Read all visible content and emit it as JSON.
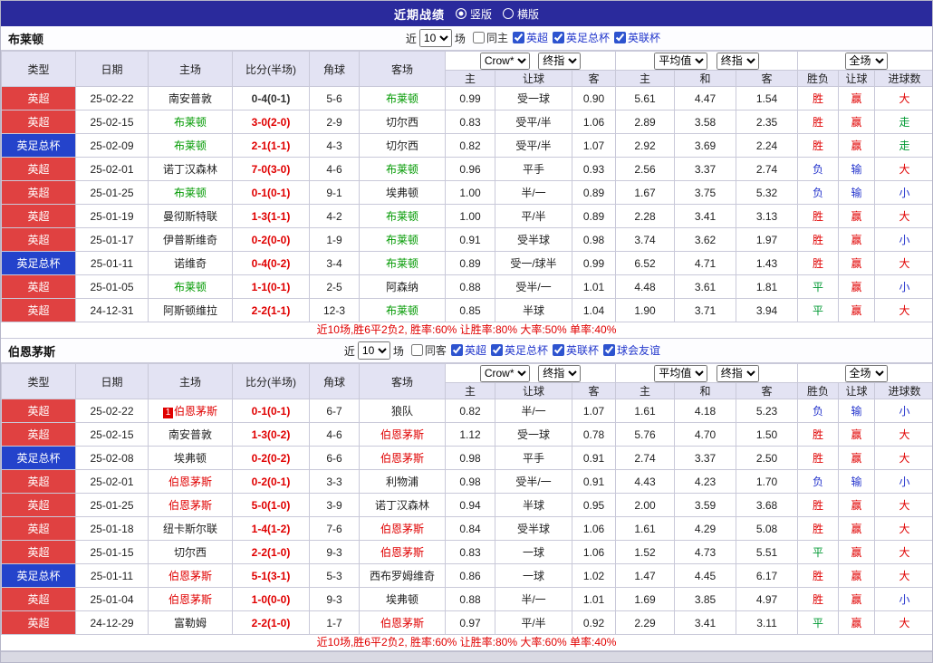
{
  "topbar": {
    "title": "近期战绩",
    "vertical_label": "竖版",
    "horizontal_label": "横版"
  },
  "colors": {
    "red": "#e00000",
    "green": "#009933",
    "blue": "#2333cc",
    "black": "#333333",
    "link": "#2136cc",
    "team_green": "#009900",
    "team_red": "#e00000",
    "comp_red": "#e04141",
    "comp_blue": "#2443cb"
  },
  "sections": [
    {
      "team": "布莱顿",
      "team_color_key": "team_green",
      "filter": {
        "near": "近",
        "count": "10",
        "games": "场",
        "checkboxes": [
          {
            "label": "同主",
            "checked": false,
            "color_key": "black"
          },
          {
            "label": "英超",
            "checked": true,
            "color_key": "link"
          },
          {
            "label": "英足总杯",
            "checked": true,
            "color_key": "link"
          },
          {
            "label": "英联杯",
            "checked": true,
            "color_key": "link"
          }
        ]
      },
      "header": {
        "cols": [
          "类型",
          "日期",
          "主场",
          "比分(半场)",
          "角球",
          "客场"
        ],
        "odds_company": "Crow*",
        "odds_stage": "终指",
        "avg_type": "平均值",
        "avg_stage": "终指",
        "scope": "全场",
        "sub_cols": [
          "主",
          "让球",
          "客",
          "主",
          "和",
          "客",
          "胜负",
          "让球",
          "进球数"
        ]
      },
      "rows": [
        {
          "comp": "英超",
          "comp_color": "red",
          "date": "25-02-22",
          "home": "南安普敦",
          "home_is_team": false,
          "card": "",
          "score": "0-4(0-1)",
          "score_color": "black",
          "corner": "5-6",
          "away": "布莱顿",
          "away_is_team": true,
          "o1": "0.99",
          "hcp": "受一球",
          "o2": "0.90",
          "m1": "5.61",
          "m2": "4.47",
          "m3": "1.54",
          "res": [
            "胜",
            "red"
          ],
          "hres": [
            "赢",
            "red"
          ],
          "goal": [
            "大",
            "red"
          ]
        },
        {
          "comp": "英超",
          "comp_color": "red",
          "date": "25-02-15",
          "home": "布莱顿",
          "home_is_team": true,
          "card": "",
          "score": "3-0(2-0)",
          "score_color": "red",
          "corner": "2-9",
          "away": "切尔西",
          "away_is_team": false,
          "o1": "0.83",
          "hcp": "受平/半",
          "o2": "1.06",
          "m1": "2.89",
          "m2": "3.58",
          "m3": "2.35",
          "res": [
            "胜",
            "red"
          ],
          "hres": [
            "赢",
            "red"
          ],
          "goal": [
            "走",
            "green"
          ]
        },
        {
          "comp": "英足总杯",
          "comp_color": "blue",
          "date": "25-02-09",
          "home": "布莱顿",
          "home_is_team": true,
          "card": "",
          "score": "2-1(1-1)",
          "score_color": "red",
          "corner": "4-3",
          "away": "切尔西",
          "away_is_team": false,
          "o1": "0.82",
          "hcp": "受平/半",
          "o2": "1.07",
          "m1": "2.92",
          "m2": "3.69",
          "m3": "2.24",
          "res": [
            "胜",
            "red"
          ],
          "hres": [
            "赢",
            "red"
          ],
          "goal": [
            "走",
            "green"
          ]
        },
        {
          "comp": "英超",
          "comp_color": "red",
          "date": "25-02-01",
          "home": "诺丁汉森林",
          "home_is_team": false,
          "card": "",
          "score": "7-0(3-0)",
          "score_color": "red",
          "corner": "4-6",
          "away": "布莱顿",
          "away_is_team": true,
          "o1": "0.96",
          "hcp": "平手",
          "o2": "0.93",
          "m1": "2.56",
          "m2": "3.37",
          "m3": "2.74",
          "res": [
            "负",
            "blue"
          ],
          "hres": [
            "输",
            "blue"
          ],
          "goal": [
            "大",
            "red"
          ]
        },
        {
          "comp": "英超",
          "comp_color": "red",
          "date": "25-01-25",
          "home": "布莱顿",
          "home_is_team": true,
          "card": "",
          "score": "0-1(0-1)",
          "score_color": "red",
          "corner": "9-1",
          "away": "埃弗顿",
          "away_is_team": false,
          "o1": "1.00",
          "hcp": "半/一",
          "o2": "0.89",
          "m1": "1.67",
          "m2": "3.75",
          "m3": "5.32",
          "res": [
            "负",
            "blue"
          ],
          "hres": [
            "输",
            "blue"
          ],
          "goal": [
            "小",
            "blue"
          ]
        },
        {
          "comp": "英超",
          "comp_color": "red",
          "date": "25-01-19",
          "home": "曼彻斯特联",
          "home_is_team": false,
          "card": "",
          "score": "1-3(1-1)",
          "score_color": "red",
          "corner": "4-2",
          "away": "布莱顿",
          "away_is_team": true,
          "o1": "1.00",
          "hcp": "平/半",
          "o2": "0.89",
          "m1": "2.28",
          "m2": "3.41",
          "m3": "3.13",
          "res": [
            "胜",
            "red"
          ],
          "hres": [
            "赢",
            "red"
          ],
          "goal": [
            "大",
            "red"
          ]
        },
        {
          "comp": "英超",
          "comp_color": "red",
          "date": "25-01-17",
          "home": "伊普斯维奇",
          "home_is_team": false,
          "card": "",
          "score": "0-2(0-0)",
          "score_color": "red",
          "corner": "1-9",
          "away": "布莱顿",
          "away_is_team": true,
          "o1": "0.91",
          "hcp": "受半球",
          "o2": "0.98",
          "m1": "3.74",
          "m2": "3.62",
          "m3": "1.97",
          "res": [
            "胜",
            "red"
          ],
          "hres": [
            "赢",
            "red"
          ],
          "goal": [
            "小",
            "blue"
          ]
        },
        {
          "comp": "英足总杯",
          "comp_color": "blue",
          "date": "25-01-11",
          "home": "诺维奇",
          "home_is_team": false,
          "card": "",
          "score": "0-4(0-2)",
          "score_color": "red",
          "corner": "3-4",
          "away": "布莱顿",
          "away_is_team": true,
          "o1": "0.89",
          "hcp": "受一/球半",
          "o2": "0.99",
          "m1": "6.52",
          "m2": "4.71",
          "m3": "1.43",
          "res": [
            "胜",
            "red"
          ],
          "hres": [
            "赢",
            "red"
          ],
          "goal": [
            "大",
            "red"
          ]
        },
        {
          "comp": "英超",
          "comp_color": "red",
          "date": "25-01-05",
          "home": "布莱顿",
          "home_is_team": true,
          "card": "",
          "score": "1-1(0-1)",
          "score_color": "red",
          "corner": "2-5",
          "away": "阿森纳",
          "away_is_team": false,
          "o1": "0.88",
          "hcp": "受半/一",
          "o2": "1.01",
          "m1": "4.48",
          "m2": "3.61",
          "m3": "1.81",
          "res": [
            "平",
            "green"
          ],
          "hres": [
            "赢",
            "red"
          ],
          "goal": [
            "小",
            "blue"
          ]
        },
        {
          "comp": "英超",
          "comp_color": "red",
          "date": "24-12-31",
          "home": "阿斯顿维拉",
          "home_is_team": false,
          "card": "",
          "score": "2-2(1-1)",
          "score_color": "red",
          "corner": "12-3",
          "away": "布莱顿",
          "away_is_team": true,
          "o1": "0.85",
          "hcp": "半球",
          "o2": "1.04",
          "m1": "1.90",
          "m2": "3.71",
          "m3": "3.94",
          "res": [
            "平",
            "green"
          ],
          "hres": [
            "赢",
            "red"
          ],
          "goal": [
            "大",
            "red"
          ]
        }
      ],
      "summary": "近10场,胜6平2负2, 胜率:60% 让胜率:80% 大率:50% 单率:40%"
    },
    {
      "team": "伯恩茅斯",
      "team_color_key": "team_red",
      "filter": {
        "near": "近",
        "count": "10",
        "games": "场",
        "checkboxes": [
          {
            "label": "同客",
            "checked": false,
            "color_key": "black"
          },
          {
            "label": "英超",
            "checked": true,
            "color_key": "link"
          },
          {
            "label": "英足总杯",
            "checked": true,
            "color_key": "link"
          },
          {
            "label": "英联杯",
            "checked": true,
            "color_key": "link"
          },
          {
            "label": "球会友谊",
            "checked": true,
            "color_key": "link"
          }
        ]
      },
      "header": {
        "cols": [
          "类型",
          "日期",
          "主场",
          "比分(半场)",
          "角球",
          "客场"
        ],
        "odds_company": "Crow*",
        "odds_stage": "终指",
        "avg_type": "平均值",
        "avg_stage": "终指",
        "scope": "全场",
        "sub_cols": [
          "主",
          "让球",
          "客",
          "主",
          "和",
          "客",
          "胜负",
          "让球",
          "进球数"
        ]
      },
      "rows": [
        {
          "comp": "英超",
          "comp_color": "red",
          "date": "25-02-22",
          "home": "伯恩茅斯",
          "home_is_team": true,
          "card": "1",
          "score": "0-1(0-1)",
          "score_color": "red",
          "corner": "6-7",
          "away": "狼队",
          "away_is_team": false,
          "o1": "0.82",
          "hcp": "半/一",
          "o2": "1.07",
          "m1": "1.61",
          "m2": "4.18",
          "m3": "5.23",
          "res": [
            "负",
            "blue"
          ],
          "hres": [
            "输",
            "blue"
          ],
          "goal": [
            "小",
            "blue"
          ]
        },
        {
          "comp": "英超",
          "comp_color": "red",
          "date": "25-02-15",
          "home": "南安普敦",
          "home_is_team": false,
          "card": "",
          "score": "1-3(0-2)",
          "score_color": "red",
          "corner": "4-6",
          "away": "伯恩茅斯",
          "away_is_team": true,
          "o1": "1.12",
          "hcp": "受一球",
          "o2": "0.78",
          "m1": "5.76",
          "m2": "4.70",
          "m3": "1.50",
          "res": [
            "胜",
            "red"
          ],
          "hres": [
            "赢",
            "red"
          ],
          "goal": [
            "大",
            "red"
          ]
        },
        {
          "comp": "英足总杯",
          "comp_color": "blue",
          "date": "25-02-08",
          "home": "埃弗顿",
          "home_is_team": false,
          "card": "",
          "score": "0-2(0-2)",
          "score_color": "red",
          "corner": "6-6",
          "away": "伯恩茅斯",
          "away_is_team": true,
          "o1": "0.98",
          "hcp": "平手",
          "o2": "0.91",
          "m1": "2.74",
          "m2": "3.37",
          "m3": "2.50",
          "res": [
            "胜",
            "red"
          ],
          "hres": [
            "赢",
            "red"
          ],
          "goal": [
            "大",
            "red"
          ]
        },
        {
          "comp": "英超",
          "comp_color": "red",
          "date": "25-02-01",
          "home": "伯恩茅斯",
          "home_is_team": true,
          "card": "",
          "score": "0-2(0-1)",
          "score_color": "red",
          "corner": "3-3",
          "away": "利物浦",
          "away_is_team": false,
          "o1": "0.98",
          "hcp": "受半/一",
          "o2": "0.91",
          "m1": "4.43",
          "m2": "4.23",
          "m3": "1.70",
          "res": [
            "负",
            "blue"
          ],
          "hres": [
            "输",
            "blue"
          ],
          "goal": [
            "小",
            "blue"
          ]
        },
        {
          "comp": "英超",
          "comp_color": "red",
          "date": "25-01-25",
          "home": "伯恩茅斯",
          "home_is_team": true,
          "card": "",
          "score": "5-0(1-0)",
          "score_color": "red",
          "corner": "3-9",
          "away": "诺丁汉森林",
          "away_is_team": false,
          "o1": "0.94",
          "hcp": "半球",
          "o2": "0.95",
          "m1": "2.00",
          "m2": "3.59",
          "m3": "3.68",
          "res": [
            "胜",
            "red"
          ],
          "hres": [
            "赢",
            "red"
          ],
          "goal": [
            "大",
            "red"
          ]
        },
        {
          "comp": "英超",
          "comp_color": "red",
          "date": "25-01-18",
          "home": "纽卡斯尔联",
          "home_is_team": false,
          "card": "",
          "score": "1-4(1-2)",
          "score_color": "red",
          "corner": "7-6",
          "away": "伯恩茅斯",
          "away_is_team": true,
          "o1": "0.84",
          "hcp": "受半球",
          "o2": "1.06",
          "m1": "1.61",
          "m2": "4.29",
          "m3": "5.08",
          "res": [
            "胜",
            "red"
          ],
          "hres": [
            "赢",
            "red"
          ],
          "goal": [
            "大",
            "red"
          ]
        },
        {
          "comp": "英超",
          "comp_color": "red",
          "date": "25-01-15",
          "home": "切尔西",
          "home_is_team": false,
          "card": "",
          "score": "2-2(1-0)",
          "score_color": "red",
          "corner": "9-3",
          "away": "伯恩茅斯",
          "away_is_team": true,
          "o1": "0.83",
          "hcp": "一球",
          "o2": "1.06",
          "m1": "1.52",
          "m2": "4.73",
          "m3": "5.51",
          "res": [
            "平",
            "green"
          ],
          "hres": [
            "赢",
            "red"
          ],
          "goal": [
            "大",
            "red"
          ]
        },
        {
          "comp": "英足总杯",
          "comp_color": "blue",
          "date": "25-01-11",
          "home": "伯恩茅斯",
          "home_is_team": true,
          "card": "",
          "score": "5-1(3-1)",
          "score_color": "red",
          "corner": "5-3",
          "away": "西布罗姆维奇",
          "away_is_team": false,
          "o1": "0.86",
          "hcp": "一球",
          "o2": "1.02",
          "m1": "1.47",
          "m2": "4.45",
          "m3": "6.17",
          "res": [
            "胜",
            "red"
          ],
          "hres": [
            "赢",
            "red"
          ],
          "goal": [
            "大",
            "red"
          ]
        },
        {
          "comp": "英超",
          "comp_color": "red",
          "date": "25-01-04",
          "home": "伯恩茅斯",
          "home_is_team": true,
          "card": "",
          "score": "1-0(0-0)",
          "score_color": "red",
          "corner": "9-3",
          "away": "埃弗顿",
          "away_is_team": false,
          "o1": "0.88",
          "hcp": "半/一",
          "o2": "1.01",
          "m1": "1.69",
          "m2": "3.85",
          "m3": "4.97",
          "res": [
            "胜",
            "red"
          ],
          "hres": [
            "赢",
            "red"
          ],
          "goal": [
            "小",
            "blue"
          ]
        },
        {
          "comp": "英超",
          "comp_color": "red",
          "date": "24-12-29",
          "home": "富勒姆",
          "home_is_team": false,
          "card": "",
          "score": "2-2(1-0)",
          "score_color": "red",
          "corner": "1-7",
          "away": "伯恩茅斯",
          "away_is_team": true,
          "o1": "0.97",
          "hcp": "平/半",
          "o2": "0.92",
          "m1": "2.29",
          "m2": "3.41",
          "m3": "3.11",
          "res": [
            "平",
            "green"
          ],
          "hres": [
            "赢",
            "red"
          ],
          "goal": [
            "大",
            "red"
          ]
        }
      ],
      "summary": "近10场,胜6平2负2, 胜率:60% 让胜率:80% 大率:60% 单率:40%"
    }
  ]
}
